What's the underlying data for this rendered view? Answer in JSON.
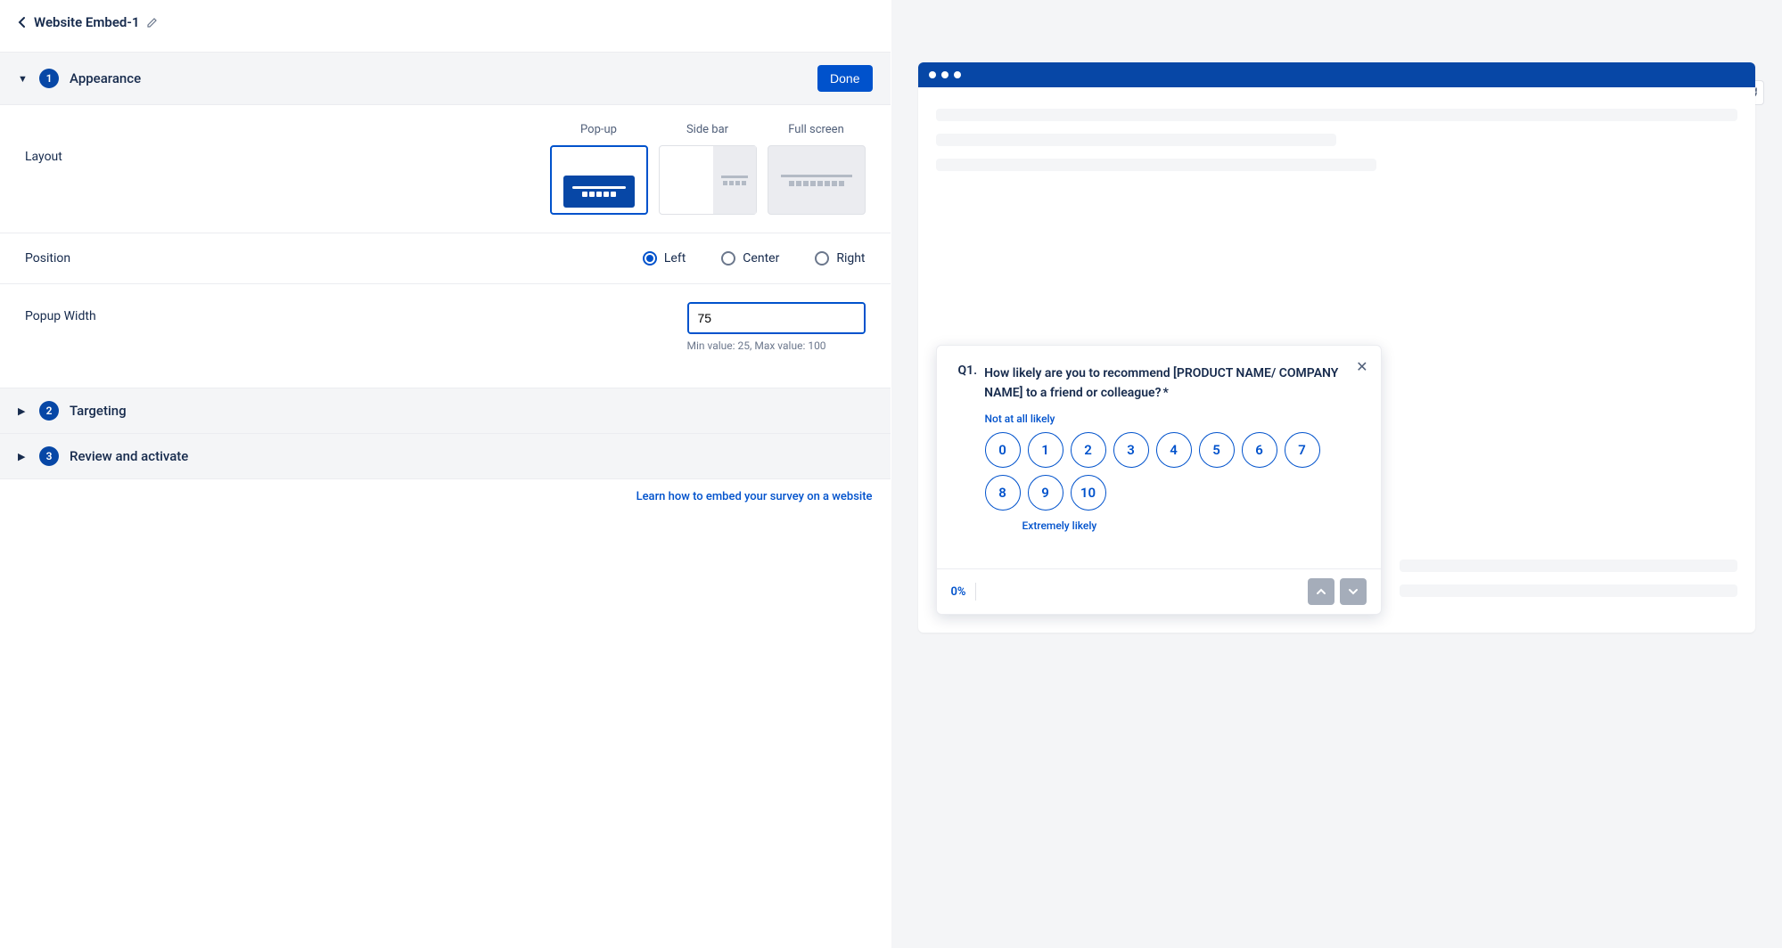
{
  "header": {
    "title": "Website Embed-1"
  },
  "sections": {
    "appearance": {
      "num": "1",
      "title": "Appearance",
      "done_label": "Done"
    },
    "targeting": {
      "num": "2",
      "title": "Targeting"
    },
    "review": {
      "num": "3",
      "title": "Review and activate"
    }
  },
  "layout": {
    "label": "Layout",
    "options": {
      "popup": "Pop-up",
      "sidebar": "Side bar",
      "fullscreen": "Full screen"
    }
  },
  "position": {
    "label": "Position",
    "options": {
      "left": "Left",
      "center": "Center",
      "right": "Right"
    }
  },
  "width": {
    "label": "Popup Width",
    "value": "75",
    "unit": "%",
    "hint": "Min value: 25, Max value: 100"
  },
  "help_link": "Learn how to embed your survey on a website",
  "preview": {
    "question_num": "Q1.",
    "question_text": "How likely are you to recommend [PRODUCT NAME/ COMPANY NAME] to a friend or colleague?",
    "required_mark": "*",
    "anchor_low": "Not at all likely",
    "anchor_high": "Extremely likely",
    "scale": [
      "0",
      "1",
      "2",
      "3",
      "4",
      "5",
      "6",
      "7",
      "8",
      "9",
      "10"
    ],
    "progress": "0%"
  }
}
